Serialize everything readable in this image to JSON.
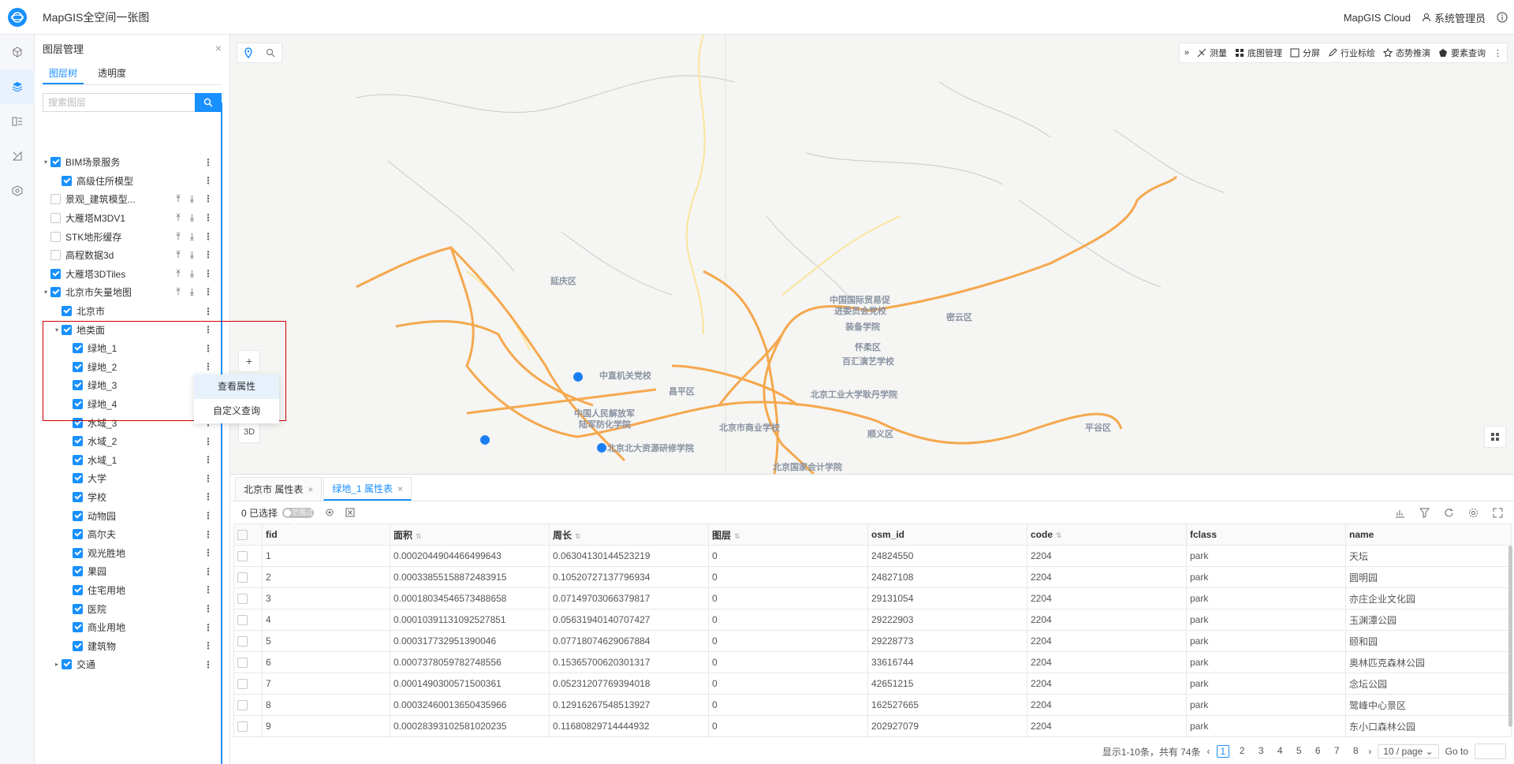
{
  "header": {
    "app_title": "MapGIS全空间一张图",
    "cloud_label": "MapGIS Cloud",
    "user_label": "系统管理员"
  },
  "rail": {
    "items": [
      "cube-icon",
      "layers-icon",
      "list-icon",
      "measure-icon",
      "package-icon"
    ]
  },
  "panel": {
    "title": "图层管理",
    "tabs": [
      "图层树",
      "透明度"
    ],
    "search_placeholder": "搜索图层",
    "tree": [
      {
        "level": 0,
        "arrow": "▾",
        "checked": true,
        "label": "BIM场景服务",
        "actions": false
      },
      {
        "level": 1,
        "arrow": "",
        "checked": true,
        "label": "高级住所模型",
        "actions": false
      },
      {
        "level": 0,
        "arrow": "",
        "checked": false,
        "label": "景观_建筑模型...",
        "actions": true
      },
      {
        "level": 0,
        "arrow": "",
        "checked": false,
        "label": "大雁塔M3DV1",
        "actions": true
      },
      {
        "level": 0,
        "arrow": "",
        "checked": false,
        "label": "STK地形缓存",
        "actions": true
      },
      {
        "level": 0,
        "arrow": "",
        "checked": false,
        "label": "高程数据3d",
        "actions": true
      },
      {
        "level": 0,
        "arrow": "",
        "checked": true,
        "label": "大雁塔3DTiles",
        "actions": true
      },
      {
        "level": 0,
        "arrow": "▾",
        "checked": true,
        "label": "北京市矢量地图",
        "actions": true
      },
      {
        "level": 1,
        "arrow": "",
        "checked": true,
        "label": "北京市",
        "actions": false
      },
      {
        "level": 1,
        "arrow": "▾",
        "checked": true,
        "label": "地类面",
        "actions": false
      },
      {
        "level": 2,
        "arrow": "",
        "checked": true,
        "label": "绿地_1",
        "actions": false
      },
      {
        "level": 2,
        "arrow": "",
        "checked": true,
        "label": "绿地_2",
        "actions": false
      },
      {
        "level": 2,
        "arrow": "",
        "checked": true,
        "label": "绿地_3",
        "actions": false
      },
      {
        "level": 2,
        "arrow": "",
        "checked": true,
        "label": "绿地_4",
        "actions": false
      },
      {
        "level": 2,
        "arrow": "",
        "checked": true,
        "label": "水域_3",
        "actions": false
      },
      {
        "level": 2,
        "arrow": "",
        "checked": true,
        "label": "水域_2",
        "actions": false
      },
      {
        "level": 2,
        "arrow": "",
        "checked": true,
        "label": "水域_1",
        "actions": false
      },
      {
        "level": 2,
        "arrow": "",
        "checked": true,
        "label": "大学",
        "actions": false
      },
      {
        "level": 2,
        "arrow": "",
        "checked": true,
        "label": "学校",
        "actions": false
      },
      {
        "level": 2,
        "arrow": "",
        "checked": true,
        "label": "动物园",
        "actions": false
      },
      {
        "level": 2,
        "arrow": "",
        "checked": true,
        "label": "高尔夫",
        "actions": false
      },
      {
        "level": 2,
        "arrow": "",
        "checked": true,
        "label": "观光胜地",
        "actions": false
      },
      {
        "level": 2,
        "arrow": "",
        "checked": true,
        "label": "果园",
        "actions": false
      },
      {
        "level": 2,
        "arrow": "",
        "checked": true,
        "label": "住宅用地",
        "actions": false
      },
      {
        "level": 2,
        "arrow": "",
        "checked": true,
        "label": "医院",
        "actions": false
      },
      {
        "level": 2,
        "arrow": "",
        "checked": true,
        "label": "商业用地",
        "actions": false
      },
      {
        "level": 2,
        "arrow": "",
        "checked": true,
        "label": "建筑物",
        "actions": false
      },
      {
        "level": 1,
        "arrow": "▸",
        "checked": true,
        "label": "交通",
        "actions": false
      }
    ],
    "context_menu": [
      "查看属性",
      "自定义查询"
    ]
  },
  "map": {
    "toolbar": [
      "»",
      "测量",
      "底图管理",
      "分屏",
      "行业标绘",
      "态势推演",
      "要素查询"
    ],
    "zoom_in": "+",
    "mode_3d": "3D",
    "places": [
      {
        "text": "延庆区"
      },
      {
        "text": "中国国际贸易促"
      },
      {
        "text": "进委员会党校"
      },
      {
        "text": "装备学院"
      },
      {
        "text": "怀柔区"
      },
      {
        "text": "密云区"
      },
      {
        "text": "百汇演艺学校"
      },
      {
        "text": "中直机关党校"
      },
      {
        "text": "昌平区"
      },
      {
        "text": "北京工业大学耿丹学院"
      },
      {
        "text": "中国人民解放军"
      },
      {
        "text": "陆军防化学院"
      },
      {
        "text": "北京市商业学校"
      },
      {
        "text": "顺义区"
      },
      {
        "text": "平谷区"
      },
      {
        "text": "北京北大资源研修学院"
      },
      {
        "text": "北京国家会计学院"
      }
    ],
    "colors": {
      "road": "#f5a84e",
      "road_light": "#fbe49b",
      "pin": "#1a7ef2"
    }
  },
  "attr": {
    "tabs": [
      {
        "label": "北京市 属性表",
        "active": false
      },
      {
        "label": "绿地_1 属性表",
        "active": true
      }
    ],
    "selected_label": "0 已选择",
    "toggle_label": "范围过滤",
    "columns": [
      "fid",
      "面积",
      "周长",
      "图层",
      "osm_id",
      "code",
      "fclass",
      "name"
    ],
    "rows": [
      [
        "1",
        "0.0002044904466499643",
        "0.06304130144523219",
        "0",
        "24824550",
        "2204",
        "park",
        "天坛"
      ],
      [
        "2",
        "0.00033855158872483915",
        "0.10520727137796934",
        "0",
        "24827108",
        "2204",
        "park",
        "圆明园"
      ],
      [
        "3",
        "0.00018034546573488658",
        "0.07149703066379817",
        "0",
        "29131054",
        "2204",
        "park",
        "亦庄企业文化园"
      ],
      [
        "4",
        "0.00010391131092527851",
        "0.05631940140707427",
        "0",
        "29222903",
        "2204",
        "park",
        "玉渊潭公园"
      ],
      [
        "5",
        "0.000317732951390046",
        "0.07718074629067884",
        "0",
        "29228773",
        "2204",
        "park",
        "颐和园"
      ],
      [
        "6",
        "0.0007378059782748556",
        "0.15365700620301317",
        "0",
        "33616744",
        "2204",
        "park",
        "奥林匹克森林公园"
      ],
      [
        "7",
        "0.0001490300571500361",
        "0.05231207769394018",
        "0",
        "42651215",
        "2204",
        "park",
        "念坛公园"
      ],
      [
        "8",
        "0.00032460013650435966",
        "0.12916267548513927",
        "0",
        "162527665",
        "2204",
        "park",
        "鹭峰中心景区"
      ],
      [
        "9",
        "0.00028393102581020235",
        "0.11680829714444932",
        "0",
        "202927079",
        "2204",
        "park",
        "东小口森林公园"
      ]
    ],
    "pager": {
      "summary": "显示1-10条，共有 74条",
      "pages": [
        "1",
        "2",
        "3",
        "4",
        "5",
        "6",
        "7",
        "8"
      ],
      "current": "1",
      "page_size": "10 / page",
      "goto": "Go to"
    }
  }
}
